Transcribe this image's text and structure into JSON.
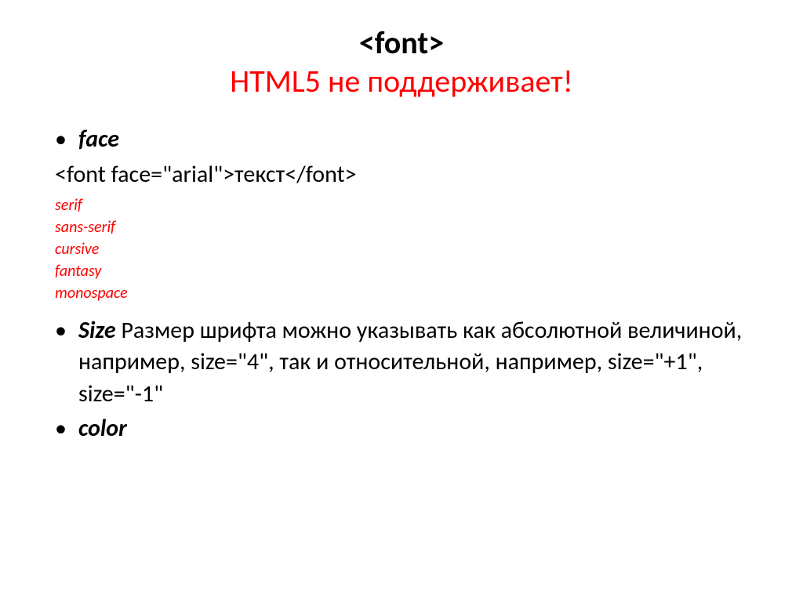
{
  "title": {
    "line1": "<font>",
    "line2": "HTML5 не поддерживает!"
  },
  "bullets": {
    "face": "face",
    "code_example": "<font face=\"arial\">текст</font>",
    "font_families": {
      "serif": "serif",
      "sans_serif": "sans-serif",
      "cursive": "cursive",
      "fantasy": "fantasy",
      "monospace": "monospace"
    },
    "size_label": "Size",
    "size_desc": " Размер шрифта можно указывать как абсолютной величиной, например, size=\"4\", так и относительной, например, size=\"+1\", size=\"-1\"",
    "color": "color"
  }
}
